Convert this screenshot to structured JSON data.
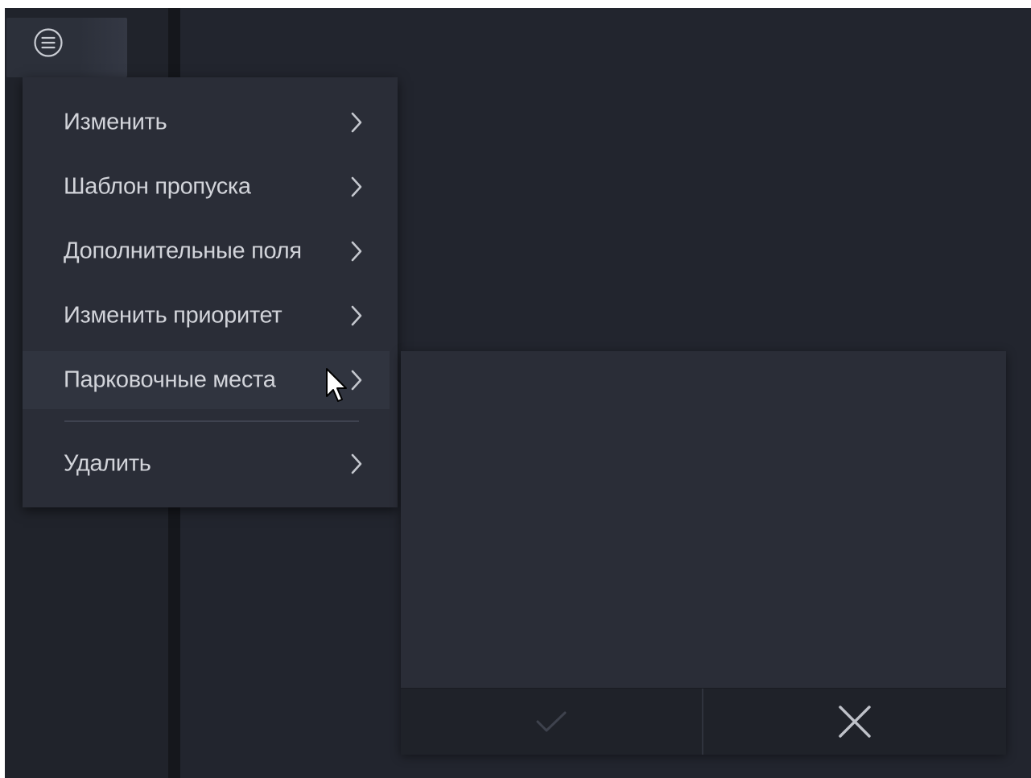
{
  "menu_button": {
    "icon": "menu-list-icon"
  },
  "menu": {
    "items": [
      {
        "label": "Изменить",
        "icon": "chevron-right-icon"
      },
      {
        "label": "Шаблон пропуска",
        "icon": "chevron-right-icon"
      },
      {
        "label": "Дополнительные поля",
        "icon": "chevron-right-icon"
      },
      {
        "label": "Изменить приоритет",
        "icon": "chevron-right-icon"
      },
      {
        "label": "Парковочные места",
        "icon": "chevron-right-icon",
        "active": true
      },
      {
        "label": "Удалить",
        "icon": "chevron-right-icon"
      }
    ]
  },
  "submenu": {
    "confirm_icon": "checkmark-icon",
    "cancel_icon": "close-icon"
  },
  "colors": {
    "background": "#22252e",
    "menu_bg": "#2a2d37",
    "menu_active_bg": "#30343f",
    "text": "#d2d4da",
    "footer_bg": "#1f2229"
  }
}
